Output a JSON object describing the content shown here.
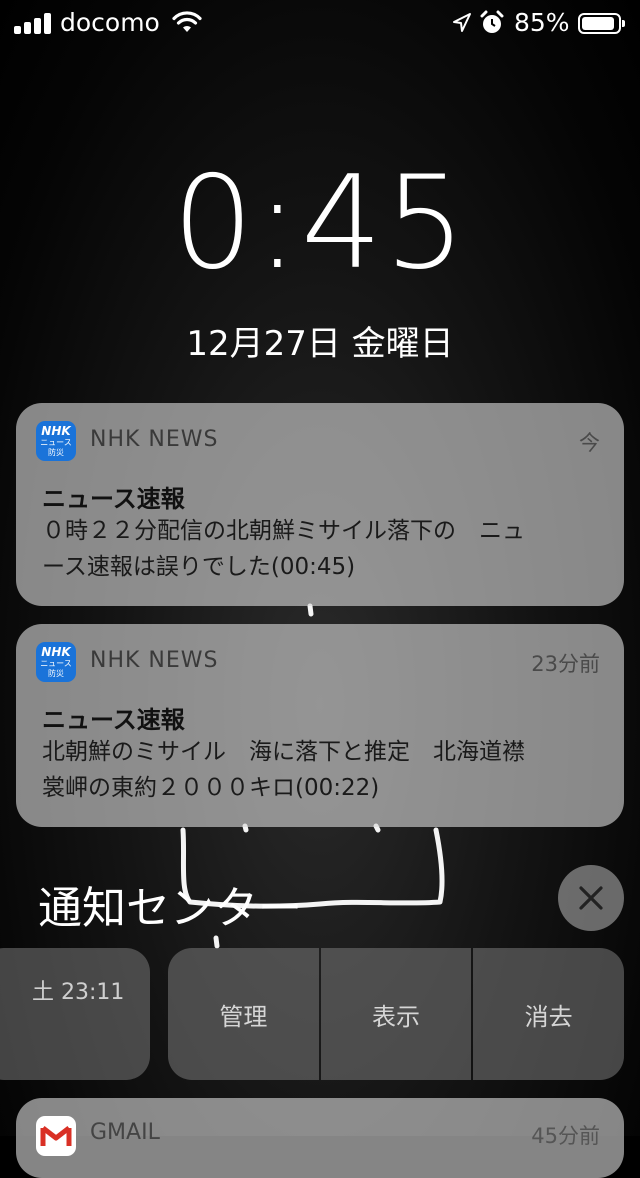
{
  "status_bar": {
    "carrier": "docomo",
    "battery_percent": "85%",
    "battery_level": 0.85
  },
  "lock_screen": {
    "time": "0:45",
    "date": "12月27日 金曜日"
  },
  "notifications": [
    {
      "app_name": "NHK NEWS",
      "icon_text_top": "NHK",
      "icon_text_mid": "ニュース",
      "icon_text_bottom": "防災",
      "time": "今",
      "title": "ニュース速報",
      "body_line1": "０時２２分配信の北朝鮮ミサイル落下の　ニュ",
      "body_line2": "ース速報は誤りでした(00:45)"
    },
    {
      "app_name": "NHK NEWS",
      "icon_text_top": "NHK",
      "icon_text_mid": "ニュース",
      "icon_text_bottom": "防災",
      "time": "23分前",
      "title": "ニュース速報",
      "body_line1": "北朝鮮のミサイル　海に落下と推定　北海道襟",
      "body_line2": "裳岬の東約２０００キロ(00:22)"
    }
  ],
  "notification_center": {
    "title": "通知センター",
    "swiped_time": "土 23:11",
    "actions": {
      "manage": "管理",
      "view": "表示",
      "clear": "消去"
    }
  },
  "bottom_notification": {
    "app_name": "GMAIL",
    "time": "45分前"
  },
  "colors": {
    "nhk_icon": "#1a73d9",
    "gmail_red": "#d93025"
  }
}
